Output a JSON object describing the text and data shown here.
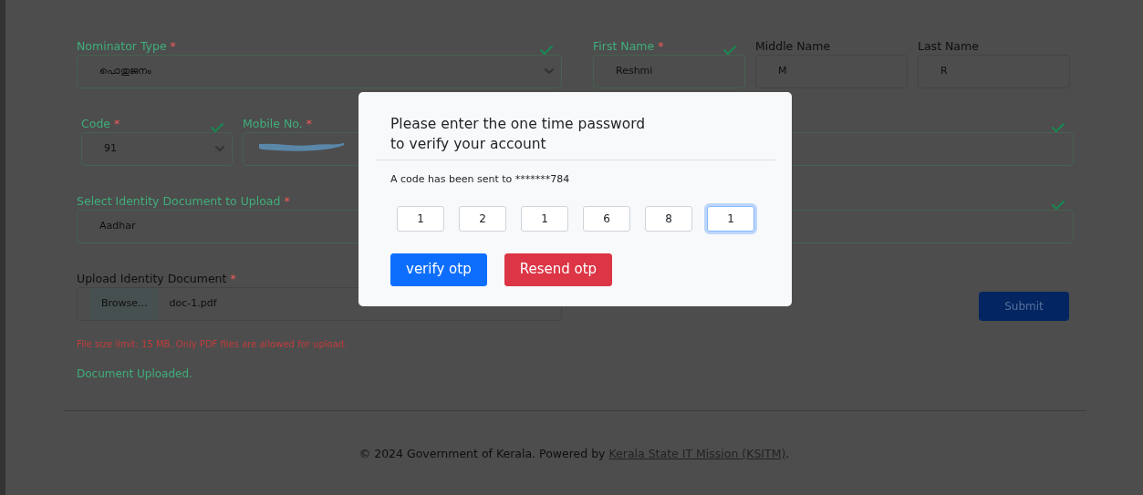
{
  "form": {
    "rows": [
      {
        "fields": [
          {
            "kind": "select",
            "label": "Nominator Type",
            "required_mark": "*",
            "valid": true,
            "check": true,
            "value": "പൊതുജനം"
          },
          {
            "kind": "text",
            "label": "First Name",
            "required_mark": "*",
            "valid": true,
            "check": true,
            "value": "Reshmi"
          },
          {
            "kind": "text",
            "label": "Middle Name",
            "valid": false,
            "value": "M"
          },
          {
            "kind": "text",
            "label": "Last Name",
            "valid": false,
            "value": "R"
          }
        ]
      },
      {
        "fields": [
          {
            "kind": "select",
            "label": "Code",
            "required_mark": "*",
            "valid": true,
            "check": true,
            "value": "91"
          },
          {
            "kind": "text",
            "label": "Mobile No.",
            "required_mark": "*",
            "valid": true,
            "redacted": true
          },
          {
            "kind": "text",
            "valid": true,
            "check": true
          }
        ]
      },
      {
        "fields": [
          {
            "kind": "plain",
            "label": "Select Identity Document to Upload",
            "required_mark": "*",
            "valid": true,
            "value": "Aadhar"
          },
          {
            "kind": "text",
            "valid": true,
            "check": true
          }
        ]
      },
      {
        "fields": [
          {
            "kind": "file",
            "label": "Upload Identity Document",
            "required_mark": "*",
            "valid": false,
            "button": "Browse...",
            "value": "doc-1.pdf"
          }
        ]
      }
    ],
    "help_text": "File size limit: 15 MB. Only PDF files are allowed for upload.",
    "status_text": "Document Uploaded.",
    "submit": "Submit"
  },
  "footer": {
    "text": "© 2024 Government of Kerala. Powered by ",
    "link": "Kerala State IT Mission (KSITM)",
    "end": "."
  },
  "modal": {
    "title_lines": [
      "Please enter the one time password",
      "to verify your account"
    ],
    "message": "A code has been sent to *******784",
    "otp": [
      {
        "digit": "1",
        "focused": false
      },
      {
        "digit": "2",
        "focused": false
      },
      {
        "digit": "1",
        "focused": false
      },
      {
        "digit": "6",
        "focused": false
      },
      {
        "digit": "8",
        "focused": false
      },
      {
        "digit": "1",
        "focused": true
      }
    ],
    "buttons": [
      {
        "label": "verify otp",
        "kind": "primary"
      },
      {
        "label": "Resend otp",
        "kind": "danger"
      }
    ]
  }
}
